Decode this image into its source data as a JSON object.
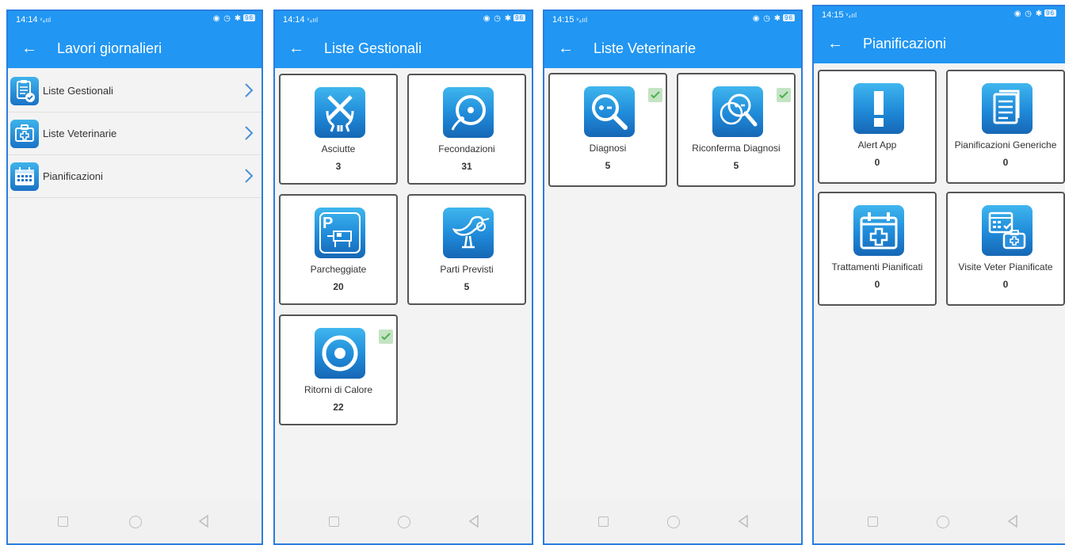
{
  "screens": [
    {
      "time": "14:14",
      "title": "Lavori giornalieri",
      "items": [
        {
          "label": "Liste Gestionali",
          "icon": "clipboard-check-icon"
        },
        {
          "label": "Liste Veterinarie",
          "icon": "medical-case-icon"
        },
        {
          "label": "Pianificazioni",
          "icon": "calendar-icon"
        }
      ]
    },
    {
      "time": "14:14",
      "title": "Liste Gestionali",
      "cards": [
        {
          "label": "Asciutte",
          "count": "3",
          "icon": "crossed-udder-icon",
          "checked": false
        },
        {
          "label": "Fecondazioni",
          "count": "31",
          "icon": "insemination-icon",
          "checked": false
        },
        {
          "label": "Parcheggiate",
          "count": "20",
          "icon": "parking-cow-icon",
          "checked": false
        },
        {
          "label": "Parti Previsti",
          "count": "5",
          "icon": "stork-icon",
          "checked": false
        },
        {
          "label": "Ritorni di Calore",
          "count": "22",
          "icon": "target-circle-icon",
          "checked": true
        }
      ]
    },
    {
      "time": "14:15",
      "title": "Liste Veterinarie",
      "cards": [
        {
          "label": "Diagnosi",
          "count": "5",
          "icon": "magnifier-plus-minus-icon",
          "checked": true
        },
        {
          "label": "Riconferma Diagnosi",
          "count": "5",
          "icon": "double-magnifier-icon",
          "checked": true
        }
      ]
    },
    {
      "time": "14:15",
      "title": "Pianificazioni",
      "cards": [
        {
          "label": "Alert App",
          "count": "0",
          "icon": "exclamation-icon",
          "checked": false
        },
        {
          "label": "Pianificazioni Generiche",
          "count": "0",
          "icon": "documents-icon",
          "checked": false
        },
        {
          "label": "Trattamenti Pianificati",
          "count": "0",
          "icon": "calendar-cross-icon",
          "checked": false
        },
        {
          "label": "Visite Veter Pianificate",
          "count": "0",
          "icon": "calendar-medkit-icon",
          "checked": false
        }
      ]
    }
  ],
  "status_indicators": "◉ ◷ ✱",
  "battery": "96",
  "back_glyph": "←",
  "colors": {
    "appbar": "#2196f3",
    "border": "#2b7ddf",
    "check": "#4caf50"
  }
}
